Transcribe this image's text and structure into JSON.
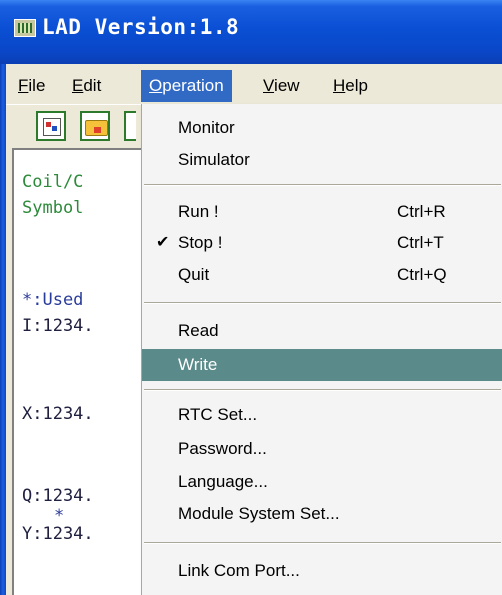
{
  "window": {
    "title": "LAD Version:1.8"
  },
  "menubar": {
    "items": [
      {
        "label": "File",
        "u": "F",
        "rest": "ile"
      },
      {
        "label": "Edit",
        "u": "E",
        "rest": "dit"
      },
      {
        "label": "Operation",
        "u": "O",
        "rest": "peration"
      },
      {
        "label": "View",
        "u": "V",
        "rest": "iew"
      },
      {
        "label": "Help",
        "u": "H",
        "rest": "elp"
      }
    ]
  },
  "work_area": {
    "lines": [
      "Coil/C",
      "Symbol",
      "*:Used",
      "I:1234.",
      "X:1234.",
      "Q:1234.",
      "*",
      "Y:1234."
    ]
  },
  "operation_menu": {
    "monitor": "Monitor",
    "simulator": "Simulator",
    "run": "Run !",
    "run_shortcut": "Ctrl+R",
    "stop": "Stop !",
    "stop_shortcut": "Ctrl+T",
    "stop_check": "✔",
    "quit": "Quit",
    "quit_shortcut": "Ctrl+Q",
    "read": "Read",
    "write": "Write",
    "rtc_set": "RTC Set...",
    "password": "Password...",
    "language": "Language...",
    "module_system_set": "Module System Set...",
    "link_com_port": "Link Com Port..."
  },
  "colors": {
    "titlebar": "#0a47c8",
    "menu_highlight": "#316ac5",
    "item_highlight": "#5a8a8a",
    "code_green": "#2d8a3a",
    "code_blue": "#2a3c9a"
  }
}
